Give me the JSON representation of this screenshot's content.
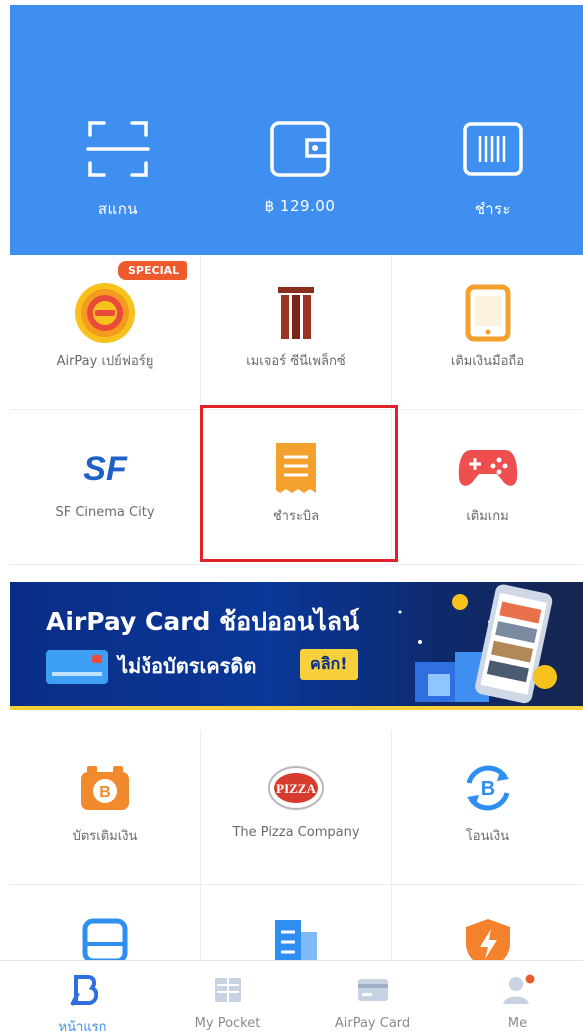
{
  "header": {
    "scan_label": "สแกน",
    "wallet_label": "฿ 129.00",
    "pay_label": "ชำระ"
  },
  "grid1": {
    "special_badge": "SPECIAL",
    "items": [
      {
        "label": "AirPay เปย์ฟอร์ยู",
        "icon": "airpay-fortune-icon"
      },
      {
        "label": "เมเจอร์ ซีนีเพล็กซ์",
        "icon": "major-cineplex-icon"
      },
      {
        "label": "เติมเงินมือถือ",
        "icon": "mobile-topup-icon"
      },
      {
        "label": "SF Cinema City",
        "icon": "sf-cinema-icon"
      },
      {
        "label": "ชำระบิล",
        "icon": "bill-payment-icon"
      },
      {
        "label": "เติมเกม",
        "icon": "game-topup-icon"
      }
    ],
    "sf_logo_text": "SF"
  },
  "banner": {
    "title": "AirPay Card ช้อปออนไลน์",
    "subtitle": "ไม่ง้อบัตรเครดิต",
    "cta": "คลิก!"
  },
  "grid2": {
    "items": [
      {
        "label": "บัตรเติมเงิน",
        "icon": "topup-card-icon"
      },
      {
        "label": "The Pizza Company",
        "icon": "pizza-company-icon"
      },
      {
        "label": "โอนเงิน",
        "icon": "transfer-icon"
      },
      {
        "label": "",
        "icon": "bus-icon"
      },
      {
        "label": "",
        "icon": "document-icon"
      },
      {
        "label": "",
        "icon": "shield-bolt-icon"
      }
    ],
    "pizza_logo_text": "PIZZA"
  },
  "tabbar": {
    "items": [
      {
        "label": "หน้าแรก",
        "active": true
      },
      {
        "label": "My Pocket",
        "active": false
      },
      {
        "label": "AirPay Card",
        "active": false
      },
      {
        "label": "Me",
        "active": false
      }
    ]
  },
  "colors": {
    "brand_blue": "#3e8ff0",
    "orange": "#f4a02c",
    "highlight_red": "#e0222a",
    "banner_yellow": "#f7d03c"
  }
}
